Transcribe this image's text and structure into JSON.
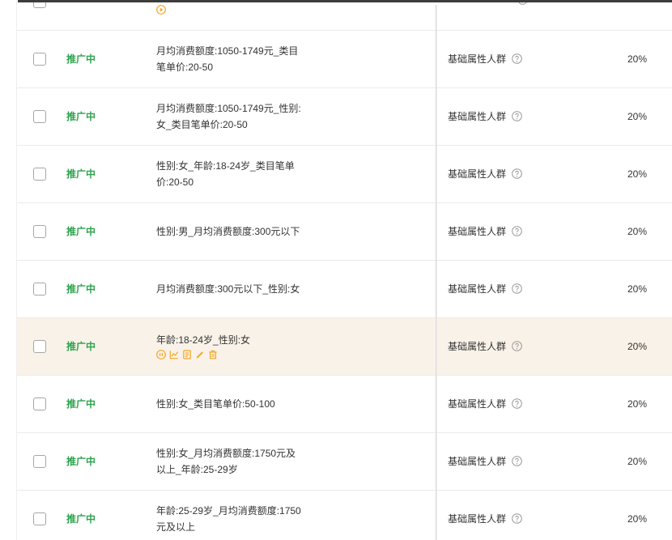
{
  "colors": {
    "status_green": "#2da44e",
    "accent_orange": "#f5a623",
    "hover_row_bg": "#f9f2e8",
    "row_border": "#ebebeb",
    "text": "#333333",
    "muted_icon": "#999999"
  },
  "table": {
    "partial_row": {
      "checked": false,
      "action_icons": [
        "play-icon"
      ],
      "help_icon": "question-circle-icon"
    },
    "rows": [
      {
        "checked": false,
        "status": "推广中",
        "name_lines": [
          "月均消费额度:1050-1749元_类目",
          "笔单价:20-50"
        ],
        "crowd_type": "基础属性人群",
        "help_icon": "question-circle-icon",
        "ratio": "20%",
        "hovered": false
      },
      {
        "checked": false,
        "status": "推广中",
        "name_lines": [
          "月均消费额度:1050-1749元_性别:",
          "女_类目笔单价:20-50"
        ],
        "crowd_type": "基础属性人群",
        "help_icon": "question-circle-icon",
        "ratio": "20%",
        "hovered": false
      },
      {
        "checked": false,
        "status": "推广中",
        "name_lines": [
          "性别:女_年龄:18-24岁_类目笔单",
          "价:20-50"
        ],
        "crowd_type": "基础属性人群",
        "help_icon": "question-circle-icon",
        "ratio": "20%",
        "hovered": false
      },
      {
        "checked": false,
        "status": "推广中",
        "name_lines": [
          "性别:男_月均消费额度:300元以下"
        ],
        "crowd_type": "基础属性人群",
        "help_icon": "question-circle-icon",
        "ratio": "20%",
        "hovered": false
      },
      {
        "checked": false,
        "status": "推广中",
        "name_lines": [
          "月均消费额度:300元以下_性别:女"
        ],
        "crowd_type": "基础属性人群",
        "help_icon": "question-circle-icon",
        "ratio": "20%",
        "hovered": false
      },
      {
        "checked": false,
        "status": "推广中",
        "name_lines": [
          "年龄:18-24岁_性别:女"
        ],
        "crowd_type": "基础属性人群",
        "help_icon": "question-circle-icon",
        "ratio": "20%",
        "hovered": true,
        "action_icons": [
          "pause-icon",
          "line-chart-icon",
          "report-icon",
          "edit-icon",
          "delete-icon"
        ]
      },
      {
        "checked": false,
        "status": "推广中",
        "name_lines": [
          "性别:女_类目笔单价:50-100"
        ],
        "crowd_type": "基础属性人群",
        "help_icon": "question-circle-icon",
        "ratio": "20%",
        "hovered": false
      },
      {
        "checked": false,
        "status": "推广中",
        "name_lines": [
          "性别:女_月均消费额度:1750元及",
          "以上_年龄:25-29岁"
        ],
        "crowd_type": "基础属性人群",
        "help_icon": "question-circle-icon",
        "ratio": "20%",
        "hovered": false
      },
      {
        "checked": false,
        "status": "推广中",
        "name_lines": [
          "年龄:25-29岁_月均消费额度:1750",
          "元及以上"
        ],
        "crowd_type": "基础属性人群",
        "help_icon": "question-circle-icon",
        "ratio": "20%",
        "hovered": false
      }
    ]
  }
}
